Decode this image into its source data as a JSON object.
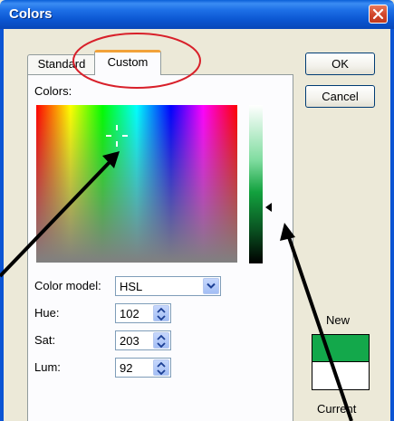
{
  "window": {
    "title": "Colors"
  },
  "tabs": [
    {
      "label": "Standard",
      "selected": false
    },
    {
      "label": "Custom",
      "selected": true
    }
  ],
  "custom": {
    "colors_label": "Colors:",
    "color_model": {
      "label": "Color model:",
      "value": "HSL"
    },
    "hue": {
      "label": "Hue:",
      "value": "102"
    },
    "sat": {
      "label": "Sat:",
      "value": "203"
    },
    "lum": {
      "label": "Lum:",
      "value": "92"
    }
  },
  "buttons": {
    "ok": "OK",
    "cancel": "Cancel"
  },
  "preview": {
    "new_label": "New",
    "current_label": "Current",
    "new_color": "#13a84b",
    "current_color": "#ffffff"
  },
  "colors": {
    "titlebar": "#0a55d0",
    "tab_highlight": "#f2a23a",
    "annotation": "#d8202a"
  },
  "icons": {
    "close": "close-icon",
    "dropdown": "chevron-down-icon",
    "spin": "spin-up-down-icon"
  }
}
